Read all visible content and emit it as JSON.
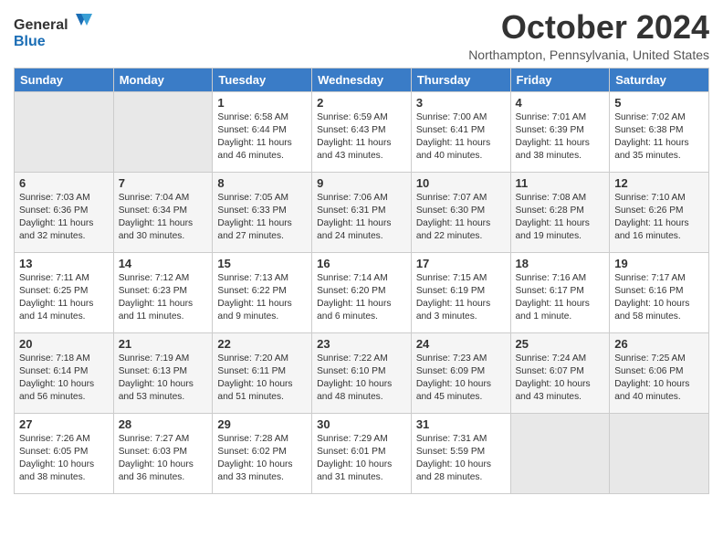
{
  "header": {
    "logo_general": "General",
    "logo_blue": "Blue",
    "month": "October 2024",
    "location": "Northampton, Pennsylvania, United States"
  },
  "weekdays": [
    "Sunday",
    "Monday",
    "Tuesday",
    "Wednesday",
    "Thursday",
    "Friday",
    "Saturday"
  ],
  "weeks": [
    [
      {
        "day": "",
        "sunrise": "",
        "sunset": "",
        "daylight": ""
      },
      {
        "day": "",
        "sunrise": "",
        "sunset": "",
        "daylight": ""
      },
      {
        "day": "1",
        "sunrise": "Sunrise: 6:58 AM",
        "sunset": "Sunset: 6:44 PM",
        "daylight": "Daylight: 11 hours and 46 minutes."
      },
      {
        "day": "2",
        "sunrise": "Sunrise: 6:59 AM",
        "sunset": "Sunset: 6:43 PM",
        "daylight": "Daylight: 11 hours and 43 minutes."
      },
      {
        "day": "3",
        "sunrise": "Sunrise: 7:00 AM",
        "sunset": "Sunset: 6:41 PM",
        "daylight": "Daylight: 11 hours and 40 minutes."
      },
      {
        "day": "4",
        "sunrise": "Sunrise: 7:01 AM",
        "sunset": "Sunset: 6:39 PM",
        "daylight": "Daylight: 11 hours and 38 minutes."
      },
      {
        "day": "5",
        "sunrise": "Sunrise: 7:02 AM",
        "sunset": "Sunset: 6:38 PM",
        "daylight": "Daylight: 11 hours and 35 minutes."
      }
    ],
    [
      {
        "day": "6",
        "sunrise": "Sunrise: 7:03 AM",
        "sunset": "Sunset: 6:36 PM",
        "daylight": "Daylight: 11 hours and 32 minutes."
      },
      {
        "day": "7",
        "sunrise": "Sunrise: 7:04 AM",
        "sunset": "Sunset: 6:34 PM",
        "daylight": "Daylight: 11 hours and 30 minutes."
      },
      {
        "day": "8",
        "sunrise": "Sunrise: 7:05 AM",
        "sunset": "Sunset: 6:33 PM",
        "daylight": "Daylight: 11 hours and 27 minutes."
      },
      {
        "day": "9",
        "sunrise": "Sunrise: 7:06 AM",
        "sunset": "Sunset: 6:31 PM",
        "daylight": "Daylight: 11 hours and 24 minutes."
      },
      {
        "day": "10",
        "sunrise": "Sunrise: 7:07 AM",
        "sunset": "Sunset: 6:30 PM",
        "daylight": "Daylight: 11 hours and 22 minutes."
      },
      {
        "day": "11",
        "sunrise": "Sunrise: 7:08 AM",
        "sunset": "Sunset: 6:28 PM",
        "daylight": "Daylight: 11 hours and 19 minutes."
      },
      {
        "day": "12",
        "sunrise": "Sunrise: 7:10 AM",
        "sunset": "Sunset: 6:26 PM",
        "daylight": "Daylight: 11 hours and 16 minutes."
      }
    ],
    [
      {
        "day": "13",
        "sunrise": "Sunrise: 7:11 AM",
        "sunset": "Sunset: 6:25 PM",
        "daylight": "Daylight: 11 hours and 14 minutes."
      },
      {
        "day": "14",
        "sunrise": "Sunrise: 7:12 AM",
        "sunset": "Sunset: 6:23 PM",
        "daylight": "Daylight: 11 hours and 11 minutes."
      },
      {
        "day": "15",
        "sunrise": "Sunrise: 7:13 AM",
        "sunset": "Sunset: 6:22 PM",
        "daylight": "Daylight: 11 hours and 9 minutes."
      },
      {
        "day": "16",
        "sunrise": "Sunrise: 7:14 AM",
        "sunset": "Sunset: 6:20 PM",
        "daylight": "Daylight: 11 hours and 6 minutes."
      },
      {
        "day": "17",
        "sunrise": "Sunrise: 7:15 AM",
        "sunset": "Sunset: 6:19 PM",
        "daylight": "Daylight: 11 hours and 3 minutes."
      },
      {
        "day": "18",
        "sunrise": "Sunrise: 7:16 AM",
        "sunset": "Sunset: 6:17 PM",
        "daylight": "Daylight: 11 hours and 1 minute."
      },
      {
        "day": "19",
        "sunrise": "Sunrise: 7:17 AM",
        "sunset": "Sunset: 6:16 PM",
        "daylight": "Daylight: 10 hours and 58 minutes."
      }
    ],
    [
      {
        "day": "20",
        "sunrise": "Sunrise: 7:18 AM",
        "sunset": "Sunset: 6:14 PM",
        "daylight": "Daylight: 10 hours and 56 minutes."
      },
      {
        "day": "21",
        "sunrise": "Sunrise: 7:19 AM",
        "sunset": "Sunset: 6:13 PM",
        "daylight": "Daylight: 10 hours and 53 minutes."
      },
      {
        "day": "22",
        "sunrise": "Sunrise: 7:20 AM",
        "sunset": "Sunset: 6:11 PM",
        "daylight": "Daylight: 10 hours and 51 minutes."
      },
      {
        "day": "23",
        "sunrise": "Sunrise: 7:22 AM",
        "sunset": "Sunset: 6:10 PM",
        "daylight": "Daylight: 10 hours and 48 minutes."
      },
      {
        "day": "24",
        "sunrise": "Sunrise: 7:23 AM",
        "sunset": "Sunset: 6:09 PM",
        "daylight": "Daylight: 10 hours and 45 minutes."
      },
      {
        "day": "25",
        "sunrise": "Sunrise: 7:24 AM",
        "sunset": "Sunset: 6:07 PM",
        "daylight": "Daylight: 10 hours and 43 minutes."
      },
      {
        "day": "26",
        "sunrise": "Sunrise: 7:25 AM",
        "sunset": "Sunset: 6:06 PM",
        "daylight": "Daylight: 10 hours and 40 minutes."
      }
    ],
    [
      {
        "day": "27",
        "sunrise": "Sunrise: 7:26 AM",
        "sunset": "Sunset: 6:05 PM",
        "daylight": "Daylight: 10 hours and 38 minutes."
      },
      {
        "day": "28",
        "sunrise": "Sunrise: 7:27 AM",
        "sunset": "Sunset: 6:03 PM",
        "daylight": "Daylight: 10 hours and 36 minutes."
      },
      {
        "day": "29",
        "sunrise": "Sunrise: 7:28 AM",
        "sunset": "Sunset: 6:02 PM",
        "daylight": "Daylight: 10 hours and 33 minutes."
      },
      {
        "day": "30",
        "sunrise": "Sunrise: 7:29 AM",
        "sunset": "Sunset: 6:01 PM",
        "daylight": "Daylight: 10 hours and 31 minutes."
      },
      {
        "day": "31",
        "sunrise": "Sunrise: 7:31 AM",
        "sunset": "Sunset: 5:59 PM",
        "daylight": "Daylight: 10 hours and 28 minutes."
      },
      {
        "day": "",
        "sunrise": "",
        "sunset": "",
        "daylight": ""
      },
      {
        "day": "",
        "sunrise": "",
        "sunset": "",
        "daylight": ""
      }
    ]
  ]
}
